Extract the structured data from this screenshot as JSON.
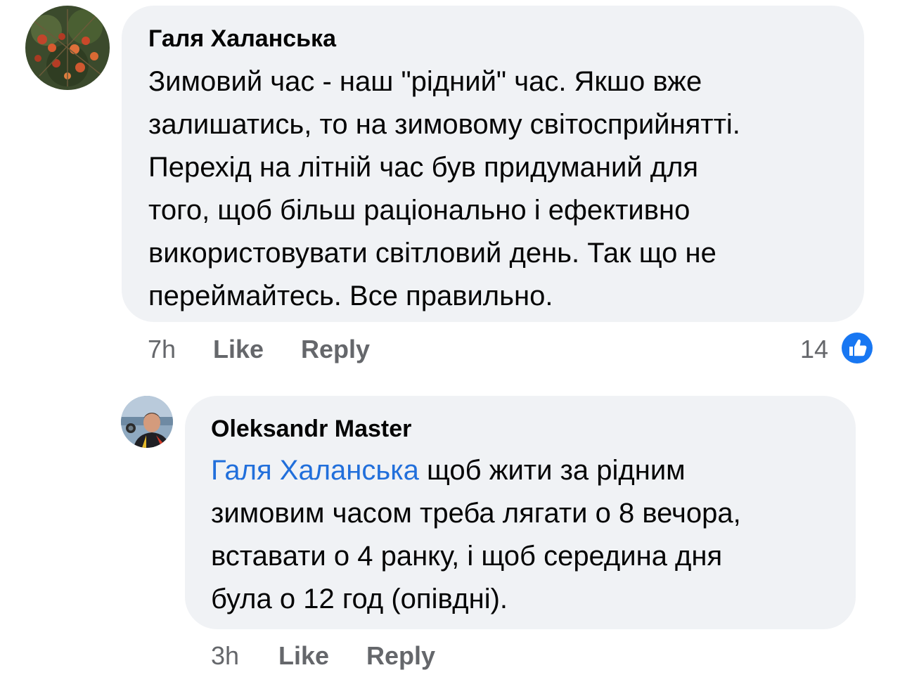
{
  "comments": [
    {
      "author": "Галя Халанська",
      "text_lines": [
        "Зимовий час - наш \"рідний\" час.  Якшо вже",
        "залишатись, то на зимовому світосприйнятті.",
        "Перехід на літній час був придуманий для",
        "того, щоб більш раціонально і ефективно",
        "використовувати світловий день. Так що не",
        "переймайтесь. Все правильно."
      ],
      "time": "7h",
      "like_label": "Like",
      "reply_label": "Reply",
      "reaction_count": "14",
      "reaction_icon": "like-reaction-icon",
      "reaction_color": "#1877f2"
    },
    {
      "author": "Oleksandr Master",
      "mention": "Галя Халанська",
      "text_first_rest": " щоб жити за рідним",
      "text_lines": [
        "зимовим часом треба лягати о 8 вечора,",
        "вставати о 4 ранку, і щоб середина дня",
        "була о 12 год (опівдні)."
      ],
      "time": "3h",
      "like_label": "Like",
      "reply_label": "Reply"
    }
  ],
  "colors": {
    "bubble": "#f0f2f5",
    "mention": "#216fdb",
    "meta": "#65676b"
  }
}
